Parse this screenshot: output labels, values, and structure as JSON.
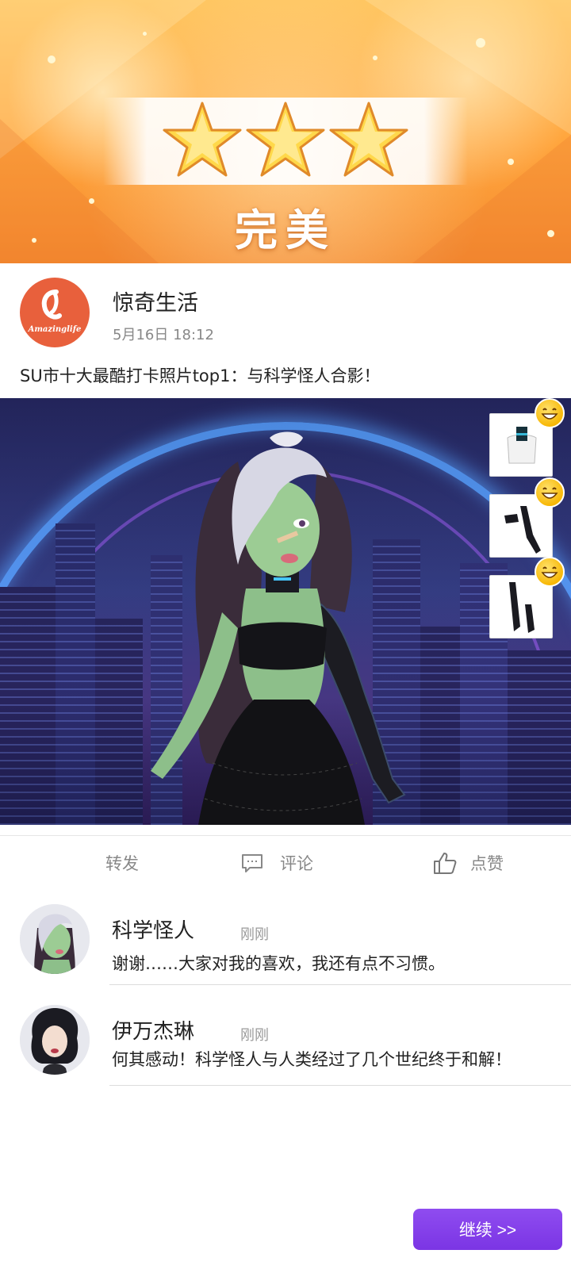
{
  "banner": {
    "stars_earned": 3,
    "stars_total": 3,
    "grade": "完美",
    "star_color": "#ffd84a"
  },
  "post": {
    "avatar_brand": "Amazinglife",
    "author": "惊奇生活",
    "timestamp": "5月16日 18:12",
    "text": "SU市十大最酷打卡照片top1：与科学怪人合影！"
  },
  "photo": {
    "items": [
      {
        "name": "collar",
        "icon": "choker-collar-icon",
        "reaction": "grin-emoji-icon"
      },
      {
        "name": "gloves",
        "icon": "arm-gloves-icon",
        "reaction": "grin-emoji-icon"
      },
      {
        "name": "stockings",
        "icon": "leg-stockings-icon",
        "reaction": "grin-emoji-icon"
      }
    ]
  },
  "actions": {
    "share": "转发",
    "comment": "评论",
    "like": "点赞"
  },
  "comments": [
    {
      "name": "科学怪人",
      "time": "刚刚",
      "text": "谢谢……大家对我的喜欢，我还有点不习惯。"
    },
    {
      "name": "伊万杰琳",
      "time": "刚刚",
      "text": "何其感动！科学怪人与人类经过了几个世纪终于和解！"
    }
  ],
  "footer": {
    "continue_label": "继续 >>",
    "accent": "#7b35e4"
  }
}
